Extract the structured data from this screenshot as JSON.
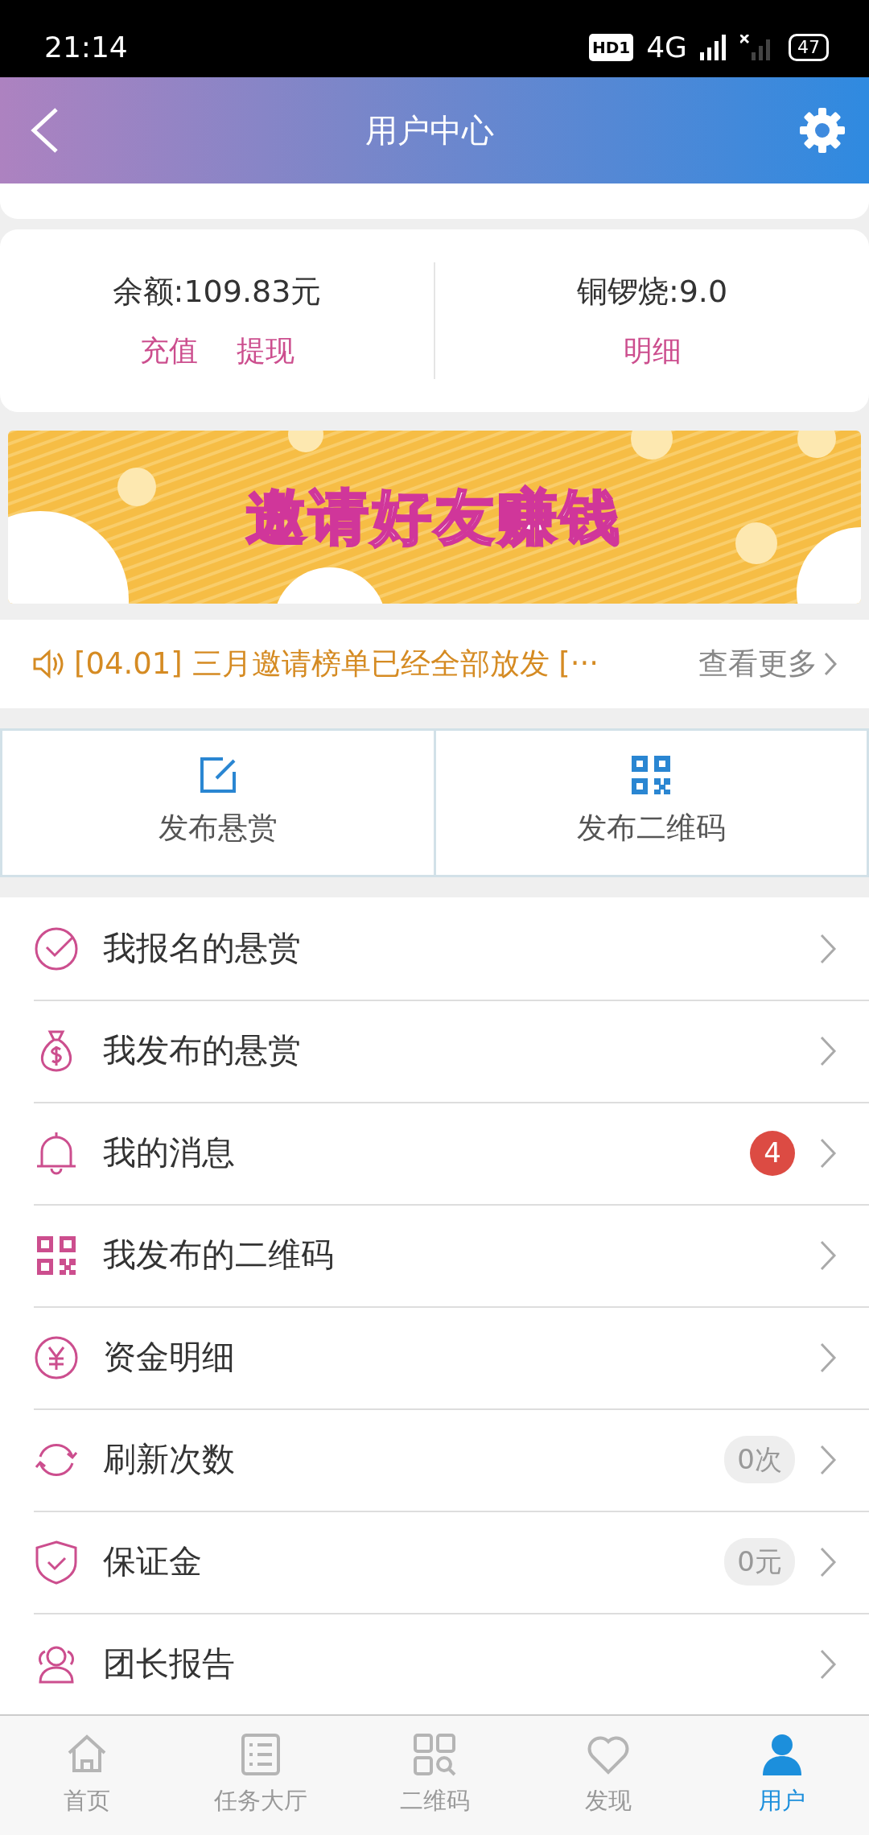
{
  "status_bar": {
    "time": "21:14",
    "hd": "HD1",
    "network": "4G",
    "battery": "47"
  },
  "header": {
    "title": "用户中心"
  },
  "balance": {
    "left": {
      "label": "余额:109.83元",
      "links": [
        "充值",
        "提现"
      ]
    },
    "right": {
      "label": "铜锣烧:9.0",
      "links": [
        "明细"
      ]
    }
  },
  "banner": {
    "title": "邀请好友赚钱"
  },
  "notice": {
    "text": "[04.01] 三月邀请榜单已经全部放发 [···",
    "more": "查看更多"
  },
  "actions": [
    {
      "label": "发布悬赏"
    },
    {
      "label": "发布二维码"
    }
  ],
  "menu": [
    {
      "label": "我报名的悬赏"
    },
    {
      "label": "我发布的悬赏"
    },
    {
      "label": "我的消息",
      "badge": "4"
    },
    {
      "label": "我发布的二维码"
    },
    {
      "label": "资金明细"
    },
    {
      "label": "刷新次数",
      "pill": "0次"
    },
    {
      "label": "保证金",
      "pill": "0元"
    },
    {
      "label": "团长报告"
    }
  ],
  "tabbar": [
    {
      "label": "首页",
      "selected": false
    },
    {
      "label": "任务大厅",
      "selected": false
    },
    {
      "label": "二维码",
      "selected": false
    },
    {
      "label": "发现",
      "selected": false
    },
    {
      "label": "用户",
      "selected": true
    }
  ]
}
